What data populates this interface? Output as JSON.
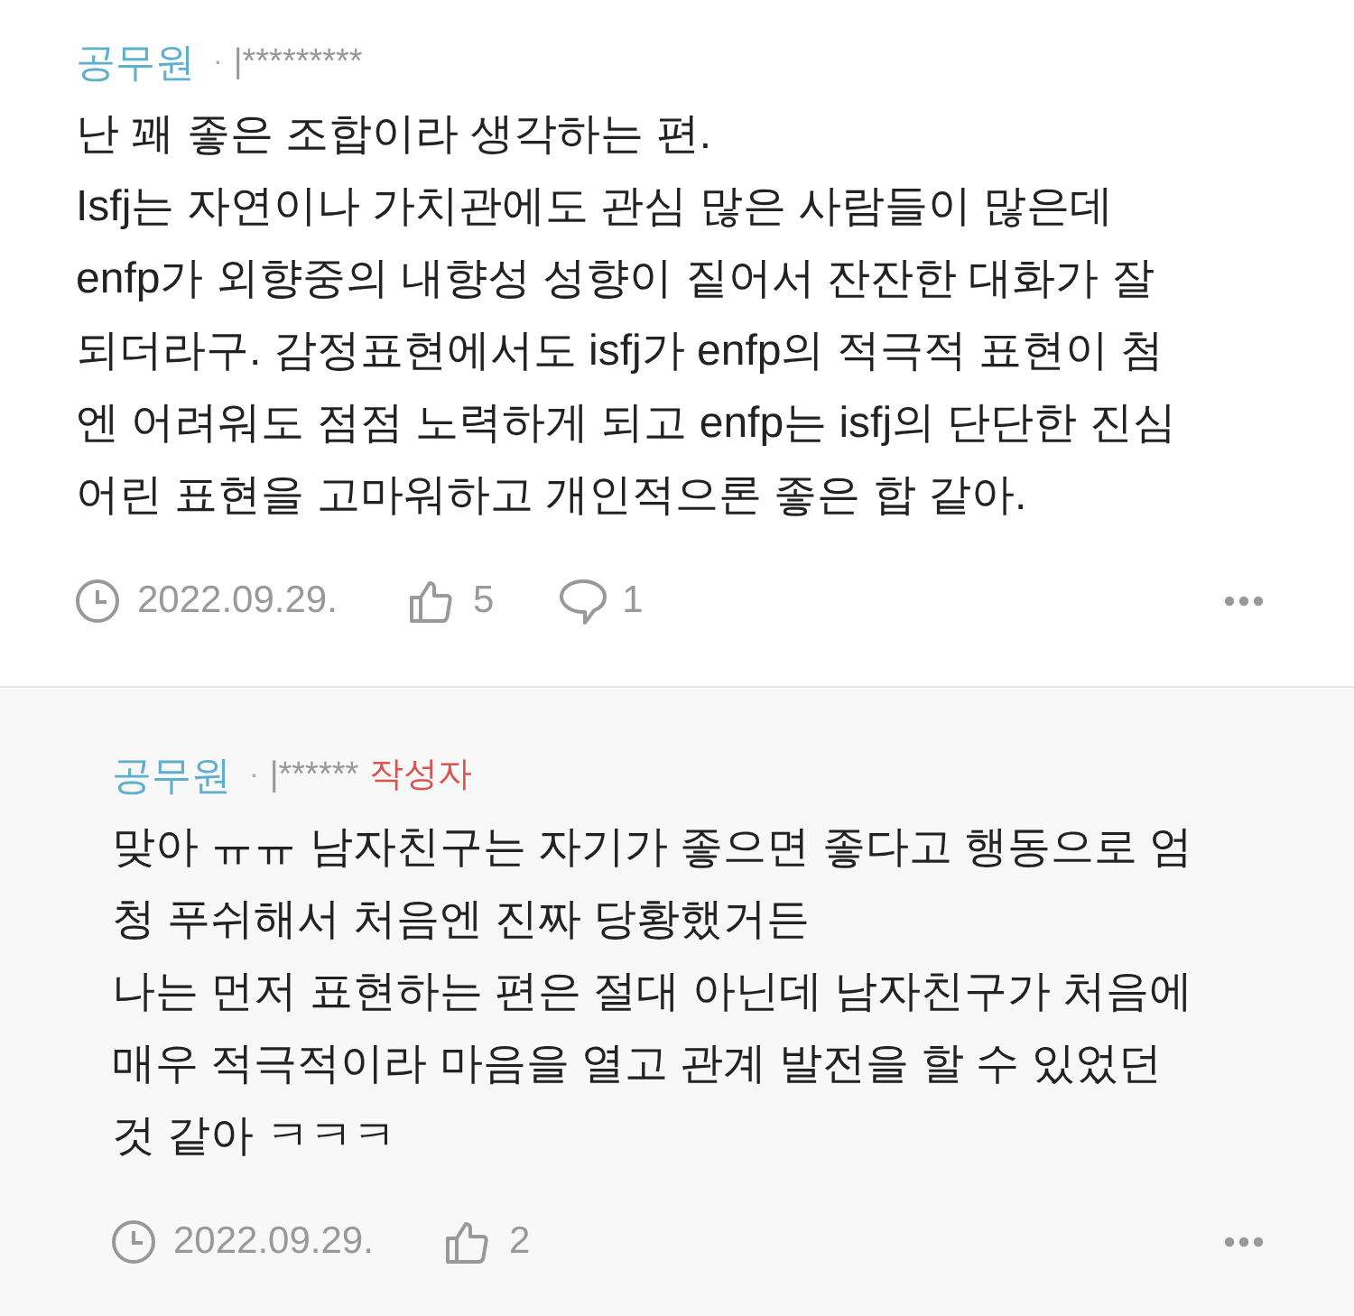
{
  "comments": [
    {
      "kind": "comment",
      "author": "공무원",
      "separator": "·",
      "user_id": "|*********",
      "body": "난 꽤 좋은 조합이라 생각하는 편.\nIsfj는 자연이나 가치관에도 관심 많은 사람들이 많은데\nenfp가 외향중의 내향성 성향이 짙어서 잔잔한 대화가 잘\n되더라구. 감정표현에서도 isfj가 enfp의 적극적 표현이 첨\n엔 어려워도 점점 노력하게 되고 enfp는 isfj의 단단한 진심\n어린 표현을 고마워하고 개인적으론 좋은 합 같아.",
      "date": "2022.09.29.",
      "likes": "5",
      "replies": "1"
    },
    {
      "kind": "reply",
      "author": "공무원",
      "separator": "·",
      "user_id": "|******",
      "badge": "작성자",
      "body": "맞아 ㅠㅠ 남자친구는 자기가 좋으면 좋다고 행동으로 엄\n청 푸쉬해서 처음엔 진짜 당황했거든\n나는 먼저 표현하는 편은 절대 아닌데 남자친구가 처음에\n매우 적극적이라 마음을 열고 관계 발전을 할 수 있었던\n것 같아 ㅋㅋㅋ",
      "date": "2022.09.29.",
      "likes": "2"
    }
  ]
}
